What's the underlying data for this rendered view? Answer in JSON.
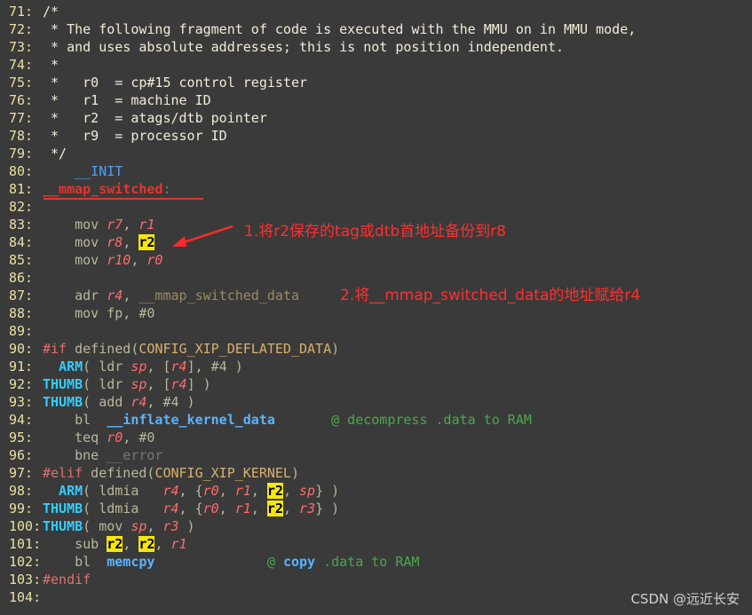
{
  "lines": [
    {
      "n": "71:",
      "parts": [
        {
          "c": "cm",
          "t": "/*"
        }
      ]
    },
    {
      "n": "72:",
      "parts": [
        {
          "c": "cm",
          "t": " * The following fragment of code is executed with the MMU on in MMU mode,"
        }
      ]
    },
    {
      "n": "73:",
      "parts": [
        {
          "c": "cm",
          "t": " * and uses absolute addresses; this is not position independent."
        }
      ]
    },
    {
      "n": "74:",
      "parts": [
        {
          "c": "cm",
          "t": " *"
        }
      ]
    },
    {
      "n": "75:",
      "parts": [
        {
          "c": "cm",
          "t": " *   r0  = cp#15 control register"
        }
      ]
    },
    {
      "n": "76:",
      "parts": [
        {
          "c": "cm",
          "t": " *   r1  = machine ID"
        }
      ]
    },
    {
      "n": "77:",
      "parts": [
        {
          "c": "cm",
          "t": " *   r2  = atags/dtb pointer"
        }
      ]
    },
    {
      "n": "78:",
      "parts": [
        {
          "c": "cm",
          "t": " *   r9  = processor ID"
        }
      ]
    },
    {
      "n": "79:",
      "parts": [
        {
          "c": "cm",
          "t": " */"
        }
      ]
    },
    {
      "n": "80:",
      "parts": [
        {
          "c": "t",
          "t": "    "
        },
        {
          "c": "init",
          "t": "__INIT"
        }
      ]
    },
    {
      "n": "81:",
      "parts": [
        {
          "c": "lb",
          "t": "__mmap_switched"
        },
        {
          "c": "gray",
          "t": ":"
        }
      ]
    },
    {
      "n": "82:",
      "parts": []
    },
    {
      "n": "83:",
      "parts": [
        {
          "c": "mn",
          "t": "    mov "
        },
        {
          "c": "rg",
          "t": "r7"
        },
        {
          "c": "mn",
          "t": ", "
        },
        {
          "c": "rg",
          "t": "r1"
        }
      ]
    },
    {
      "n": "84:",
      "parts": [
        {
          "c": "mn",
          "t": "    mov "
        },
        {
          "c": "rg",
          "t": "r8"
        },
        {
          "c": "mn",
          "t": ", "
        },
        {
          "c": "hl",
          "t": "r2"
        }
      ]
    },
    {
      "n": "85:",
      "parts": [
        {
          "c": "mn",
          "t": "    mov "
        },
        {
          "c": "rg",
          "t": "r10"
        },
        {
          "c": "mn",
          "t": ", "
        },
        {
          "c": "rg",
          "t": "r0"
        }
      ]
    },
    {
      "n": "86:",
      "parts": []
    },
    {
      "n": "87:",
      "parts": [
        {
          "c": "mn",
          "t": "    adr "
        },
        {
          "c": "rg",
          "t": "r4"
        },
        {
          "c": "mn",
          "t": ", "
        },
        {
          "c": "olive",
          "t": "__mmap_switched_data"
        }
      ]
    },
    {
      "n": "88:",
      "parts": [
        {
          "c": "mn",
          "t": "    mov fp, #0"
        }
      ]
    },
    {
      "n": "89:",
      "parts": []
    },
    {
      "n": "90:",
      "parts": [
        {
          "c": "pp",
          "t": "#if"
        },
        {
          "c": "mn",
          "t": " defined("
        },
        {
          "c": "cf",
          "t": "CONFIG_XIP_DEFLATED_DATA"
        },
        {
          "c": "mn",
          "t": ")"
        }
      ]
    },
    {
      "n": "91:",
      "parts": [
        {
          "c": "t",
          "t": "  "
        },
        {
          "c": "ic",
          "t": "ARM"
        },
        {
          "c": "mn",
          "t": "( ldr "
        },
        {
          "c": "rg",
          "t": "sp"
        },
        {
          "c": "mn",
          "t": ", ["
        },
        {
          "c": "rg",
          "t": "r4"
        },
        {
          "c": "mn",
          "t": "], #4 )"
        }
      ]
    },
    {
      "n": "92:",
      "parts": [
        {
          "c": "ic",
          "t": "THUMB"
        },
        {
          "c": "mn",
          "t": "( ldr "
        },
        {
          "c": "rg",
          "t": "sp"
        },
        {
          "c": "mn",
          "t": ", ["
        },
        {
          "c": "rg",
          "t": "r4"
        },
        {
          "c": "mn",
          "t": "] )"
        }
      ]
    },
    {
      "n": "93:",
      "parts": [
        {
          "c": "ic",
          "t": "THUMB"
        },
        {
          "c": "mn",
          "t": "( add "
        },
        {
          "c": "rg",
          "t": "r4"
        },
        {
          "c": "mn",
          "t": ", #4 )"
        }
      ]
    },
    {
      "n": "94:",
      "parts": [
        {
          "c": "mn",
          "t": "    bl  "
        },
        {
          "c": "fn",
          "t": "__inflate_kernel_data"
        },
        {
          "c": "t",
          "t": "       "
        },
        {
          "c": "cmt",
          "t": "@ decompress .data to RAM"
        }
      ]
    },
    {
      "n": "95:",
      "parts": [
        {
          "c": "mn",
          "t": "    teq "
        },
        {
          "c": "rg",
          "t": "r0"
        },
        {
          "c": "mn",
          "t": ", #0"
        }
      ]
    },
    {
      "n": "96:",
      "parts": [
        {
          "c": "mn",
          "t": "    bne "
        },
        {
          "c": "gray",
          "t": "__error"
        }
      ]
    },
    {
      "n": "97:",
      "parts": [
        {
          "c": "pp",
          "t": "#elif"
        },
        {
          "c": "mn",
          "t": " defined("
        },
        {
          "c": "cf",
          "t": "CONFIG_XIP_KERNEL"
        },
        {
          "c": "mn",
          "t": ")"
        }
      ]
    },
    {
      "n": "98:",
      "parts": [
        {
          "c": "t",
          "t": "  "
        },
        {
          "c": "ic",
          "t": "ARM"
        },
        {
          "c": "mn",
          "t": "( ldmia   "
        },
        {
          "c": "rg",
          "t": "r4"
        },
        {
          "c": "mn",
          "t": ", {"
        },
        {
          "c": "rg",
          "t": "r0"
        },
        {
          "c": "mn",
          "t": ", "
        },
        {
          "c": "rg",
          "t": "r1"
        },
        {
          "c": "mn",
          "t": ", "
        },
        {
          "c": "hl",
          "t": "r2"
        },
        {
          "c": "mn",
          "t": ", "
        },
        {
          "c": "rg",
          "t": "sp"
        },
        {
          "c": "mn",
          "t": "} )"
        }
      ]
    },
    {
      "n": "99:",
      "parts": [
        {
          "c": "ic",
          "t": "THUMB"
        },
        {
          "c": "mn",
          "t": "( ldmia   "
        },
        {
          "c": "rg",
          "t": "r4"
        },
        {
          "c": "mn",
          "t": ", {"
        },
        {
          "c": "rg",
          "t": "r0"
        },
        {
          "c": "mn",
          "t": ", "
        },
        {
          "c": "rg",
          "t": "r1"
        },
        {
          "c": "mn",
          "t": ", "
        },
        {
          "c": "hl",
          "t": "r2"
        },
        {
          "c": "mn",
          "t": ", "
        },
        {
          "c": "rg",
          "t": "r3"
        },
        {
          "c": "mn",
          "t": "} )"
        }
      ]
    },
    {
      "n": "100:",
      "parts": [
        {
          "c": "ic",
          "t": "THUMB"
        },
        {
          "c": "mn",
          "t": "( mov "
        },
        {
          "c": "rg",
          "t": "sp"
        },
        {
          "c": "mn",
          "t": ", "
        },
        {
          "c": "rg",
          "t": "r3"
        },
        {
          "c": "mn",
          "t": " )"
        }
      ]
    },
    {
      "n": "101:",
      "parts": [
        {
          "c": "mn",
          "t": "    sub "
        },
        {
          "c": "hl",
          "t": "r2"
        },
        {
          "c": "mn",
          "t": ", "
        },
        {
          "c": "hl",
          "t": "r2"
        },
        {
          "c": "mn",
          "t": ", "
        },
        {
          "c": "rg",
          "t": "r1"
        }
      ]
    },
    {
      "n": "102:",
      "parts": [
        {
          "c": "mn",
          "t": "    bl  "
        },
        {
          "c": "fn",
          "t": "memcpy"
        },
        {
          "c": "t",
          "t": "              "
        },
        {
          "c": "cmt",
          "t": "@ "
        },
        {
          "c": "fn",
          "t": "copy"
        },
        {
          "c": "cmt",
          "t": " .data to RAM"
        }
      ]
    },
    {
      "n": "103:",
      "parts": [
        {
          "c": "pp",
          "t": "#endif"
        }
      ]
    },
    {
      "n": "104:",
      "parts": []
    }
  ],
  "annotations": {
    "note1": "1.将r2保存的tag或dtb首地址备份到r8",
    "note2": "2.将__mmap_switched_data的地址赋给r4"
  },
  "watermark": "CSDN @远近长安",
  "colors": {
    "background": "#3a3a3a",
    "annotation": "#ff3030",
    "highlight": "#f5e60f"
  }
}
